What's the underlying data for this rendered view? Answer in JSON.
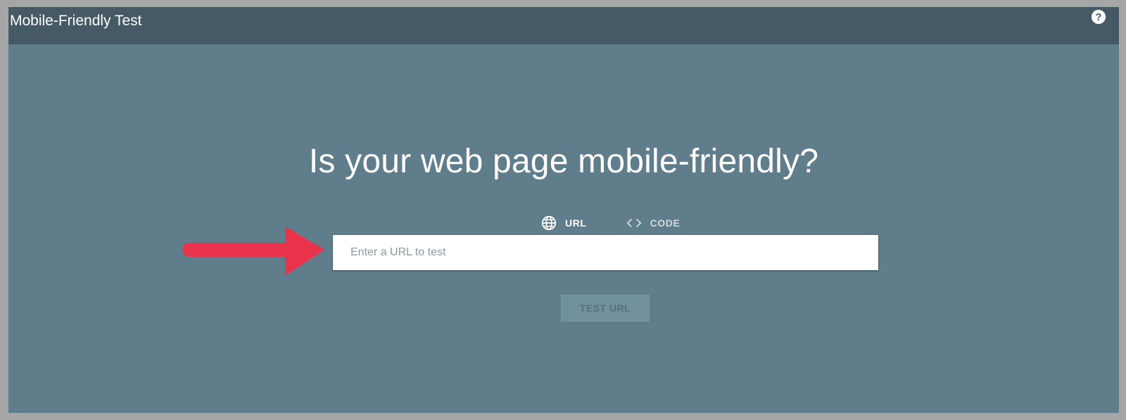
{
  "header": {
    "title": "Mobile-Friendly Test",
    "help_icon": "question-circle-icon"
  },
  "main": {
    "headline": "Is your web page mobile-friendly?",
    "tabs": [
      {
        "label": "URL",
        "icon": "globe-icon",
        "active": true
      },
      {
        "label": "CODE",
        "icon": "code-brackets-icon",
        "active": false
      }
    ],
    "url_input": {
      "placeholder": "Enter a URL to test",
      "value": ""
    },
    "test_button": {
      "label": "TEST URL",
      "enabled": false
    }
  },
  "annotation": {
    "arrow_icon": "right-arrow-icon",
    "arrow_color": "#e8334a"
  },
  "colors": {
    "page_background": "#607d8b",
    "header_background": "#455a64",
    "active_tab_underline": "#f4b400",
    "outer_border": "#a6a6a6"
  }
}
